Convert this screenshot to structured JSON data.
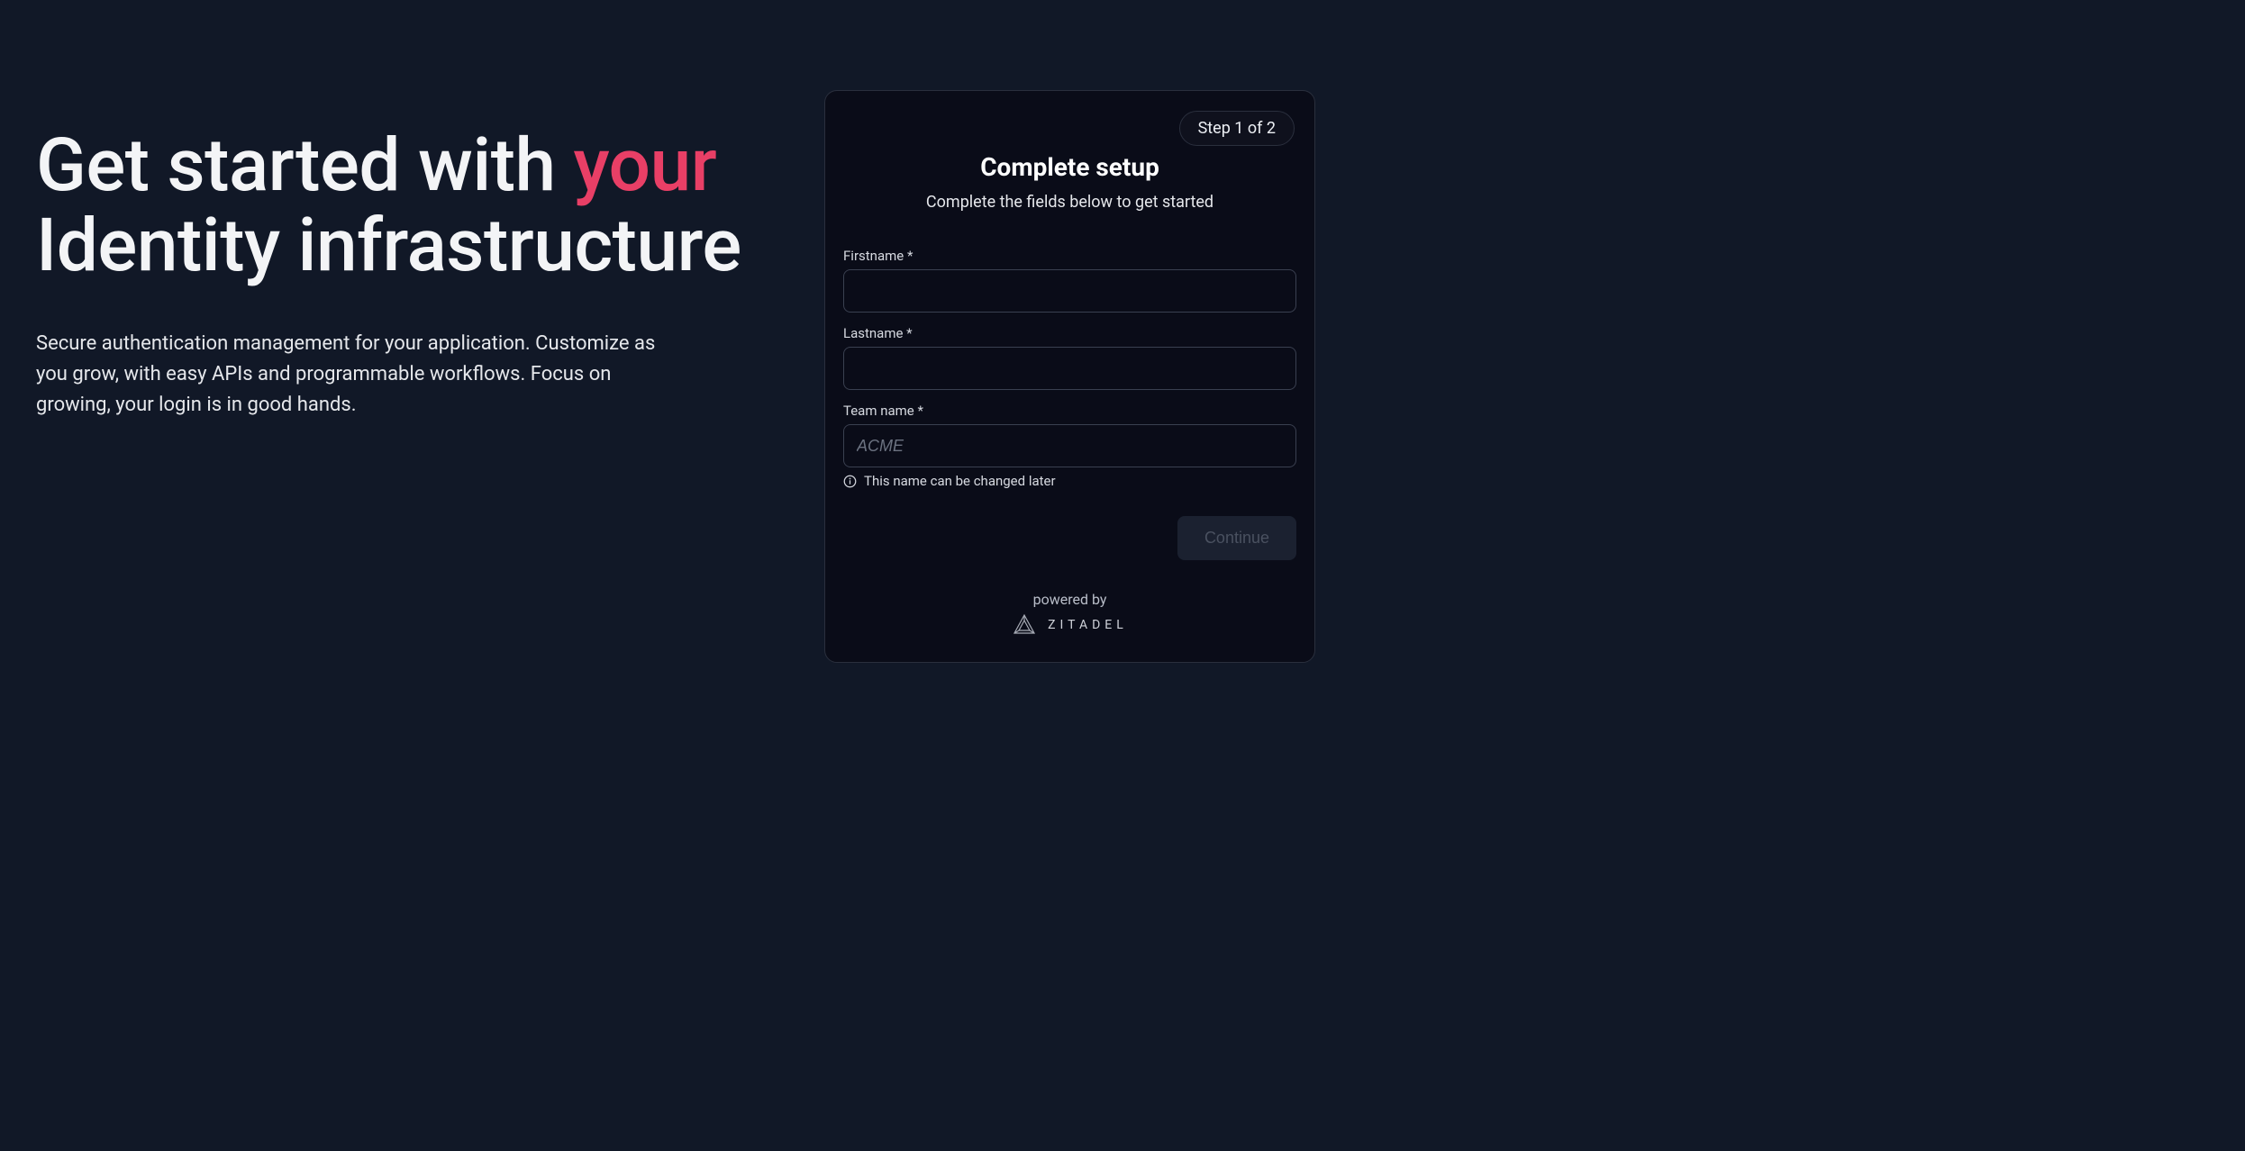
{
  "hero": {
    "title_pre": "Get started with ",
    "title_accent": "your",
    "title_post": " Identity infrastructure",
    "subtitle": "Secure authentication management for your application. Customize as you grow, with easy APIs and programmable workflows. Focus on growing, your login is in good hands."
  },
  "card": {
    "step_badge": "Step 1 of 2",
    "title": "Complete setup",
    "subtitle": "Complete the fields below to get started",
    "fields": {
      "firstname_label": "Firstname *",
      "firstname_value": "",
      "lastname_label": "Lastname *",
      "lastname_value": "",
      "teamname_label": "Team name *",
      "teamname_value": "",
      "teamname_placeholder": "ACME",
      "teamname_hint": "This name can be changed later"
    },
    "continue_label": "Continue"
  },
  "footer": {
    "powered_by": "powered by",
    "brand": "ZITADEL"
  }
}
